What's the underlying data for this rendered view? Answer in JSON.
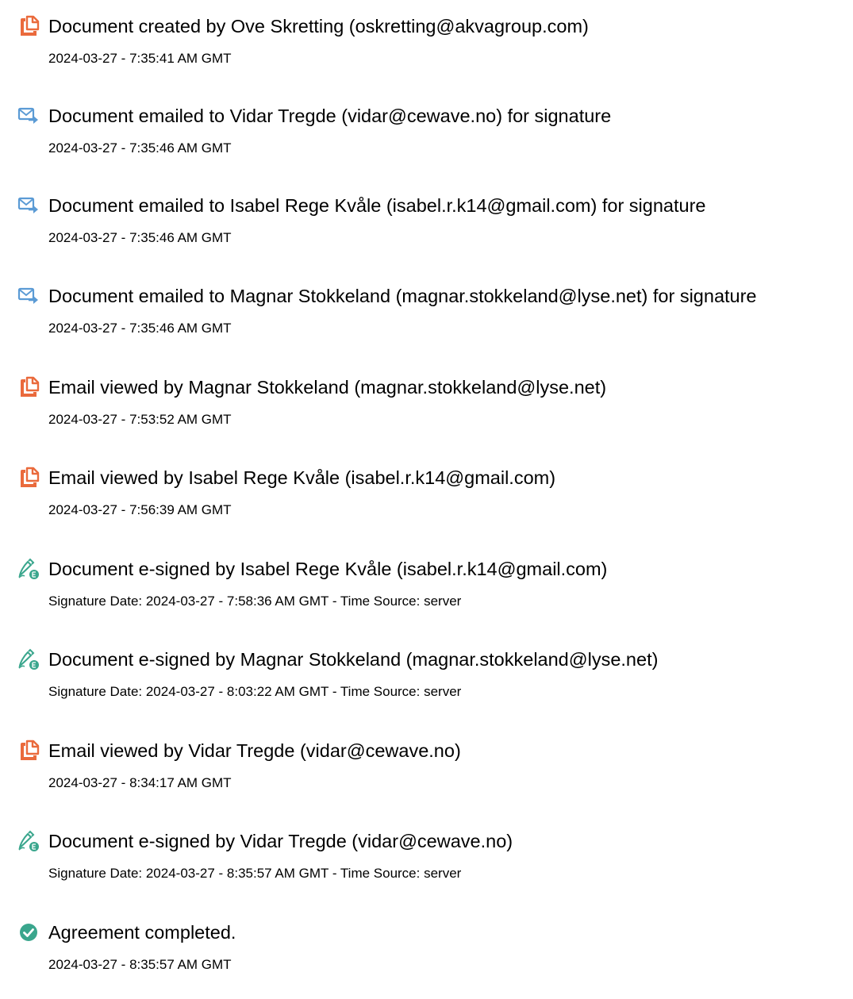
{
  "colors": {
    "doc_icon": "#ea6a3c",
    "email_icon": "#5b9bd5",
    "sign_icon": "#3aa68d",
    "complete_icon": "#3aa68d"
  },
  "events": [
    {
      "icon": "document-icon",
      "title": "Document created by Ove Skretting (oskretting@akvagroup.com)",
      "subtitle": "2024-03-27 - 7:35:41 AM GMT"
    },
    {
      "icon": "email-sent-icon",
      "title": "Document emailed to Vidar Tregde (vidar@cewave.no) for signature",
      "subtitle": "2024-03-27 - 7:35:46 AM GMT"
    },
    {
      "icon": "email-sent-icon",
      "title": "Document emailed to Isabel Rege Kvåle (isabel.r.k14@gmail.com) for signature",
      "subtitle": "2024-03-27 - 7:35:46 AM GMT"
    },
    {
      "icon": "email-sent-icon",
      "title": "Document emailed to Magnar Stokkeland (magnar.stokkeland@lyse.net) for signature",
      "subtitle": "2024-03-27 - 7:35:46 AM GMT"
    },
    {
      "icon": "document-icon",
      "title": "Email viewed by Magnar Stokkeland (magnar.stokkeland@lyse.net)",
      "subtitle": "2024-03-27 - 7:53:52 AM GMT"
    },
    {
      "icon": "document-icon",
      "title": "Email viewed by Isabel Rege Kvåle (isabel.r.k14@gmail.com)",
      "subtitle": "2024-03-27 - 7:56:39 AM GMT"
    },
    {
      "icon": "esign-icon",
      "title": "Document e-signed by Isabel Rege Kvåle (isabel.r.k14@gmail.com)",
      "subtitle": "Signature Date: 2024-03-27 - 7:58:36 AM GMT - Time Source: server"
    },
    {
      "icon": "esign-icon",
      "title": "Document e-signed by Magnar Stokkeland (magnar.stokkeland@lyse.net)",
      "subtitle": "Signature Date: 2024-03-27 - 8:03:22 AM GMT - Time Source: server"
    },
    {
      "icon": "document-icon",
      "title": "Email viewed by Vidar Tregde (vidar@cewave.no)",
      "subtitle": "2024-03-27 - 8:34:17 AM GMT"
    },
    {
      "icon": "esign-icon",
      "title": "Document e-signed by Vidar Tregde (vidar@cewave.no)",
      "subtitle": "Signature Date: 2024-03-27 - 8:35:57 AM GMT - Time Source: server"
    },
    {
      "icon": "check-circle-icon",
      "title": "Agreement completed.",
      "subtitle": "2024-03-27 - 8:35:57 AM GMT"
    }
  ]
}
